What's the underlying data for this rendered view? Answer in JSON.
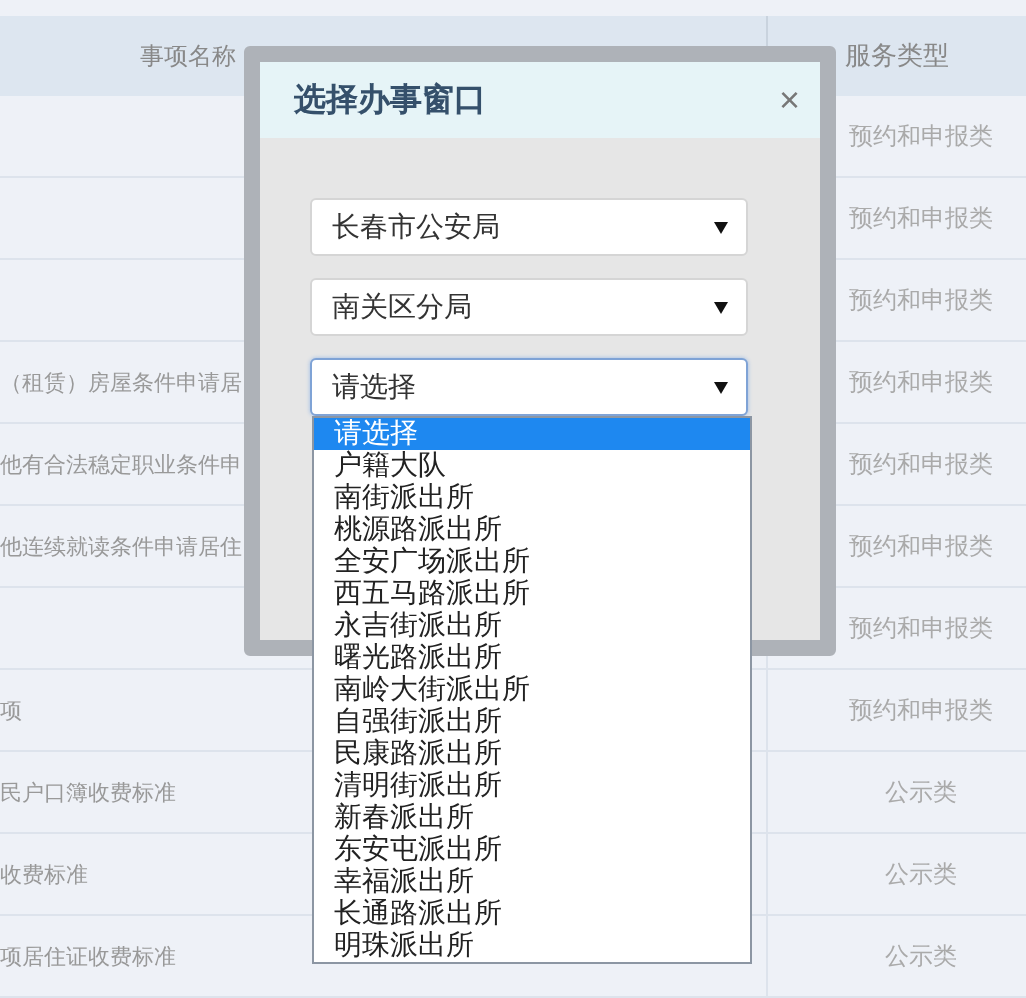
{
  "table": {
    "columns": [
      "事项名称",
      "服务类型"
    ],
    "rows": [
      {
        "type": "预约和申报类"
      },
      {
        "type": "预约和申报类"
      },
      {
        "type": "预约和申报类"
      },
      {
        "name": "（租赁）房屋条件申请居",
        "type": "预约和申报类"
      },
      {
        "name": "他有合法稳定职业条件申",
        "type": "预约和申报类"
      },
      {
        "name": "他连续就读条件申请居住",
        "type": "预约和申报类"
      },
      {
        "type": "预约和申报类"
      },
      {
        "name": "项",
        "type": "预约和申报类"
      },
      {
        "name": "民户口簿收费标准",
        "type": "公示类"
      },
      {
        "name": "收费标准",
        "type": "公示类"
      },
      {
        "name": "项居住证收费标准",
        "type": "公示类"
      }
    ]
  },
  "dialog": {
    "title": "选择办事窗口",
    "close": "×",
    "selects": [
      {
        "value": "长春市公安局",
        "focused": false
      },
      {
        "value": "南关区分局",
        "focused": false
      },
      {
        "value": "请选择",
        "focused": true,
        "options": [
          {
            "label": "请选择",
            "selected": true
          },
          {
            "label": "户籍大队",
            "selected": false
          },
          {
            "label": "南街派出所",
            "selected": false
          },
          {
            "label": "桃源路派出所",
            "selected": false
          },
          {
            "label": "全安广场派出所",
            "selected": false
          },
          {
            "label": "西五马路派出所",
            "selected": false
          },
          {
            "label": "永吉街派出所",
            "selected": false
          },
          {
            "label": "曙光路派出所",
            "selected": false
          },
          {
            "label": "南岭大街派出所",
            "selected": false
          },
          {
            "label": "自强街派出所",
            "selected": false
          },
          {
            "label": "民康路派出所",
            "selected": false
          },
          {
            "label": "清明街派出所",
            "selected": false
          },
          {
            "label": "新春派出所",
            "selected": false
          },
          {
            "label": "东安屯派出所",
            "selected": false
          },
          {
            "label": "幸福派出所",
            "selected": false
          },
          {
            "label": "长通路派出所",
            "selected": false
          },
          {
            "label": "明珠派出所",
            "selected": false
          }
        ]
      }
    ]
  }
}
